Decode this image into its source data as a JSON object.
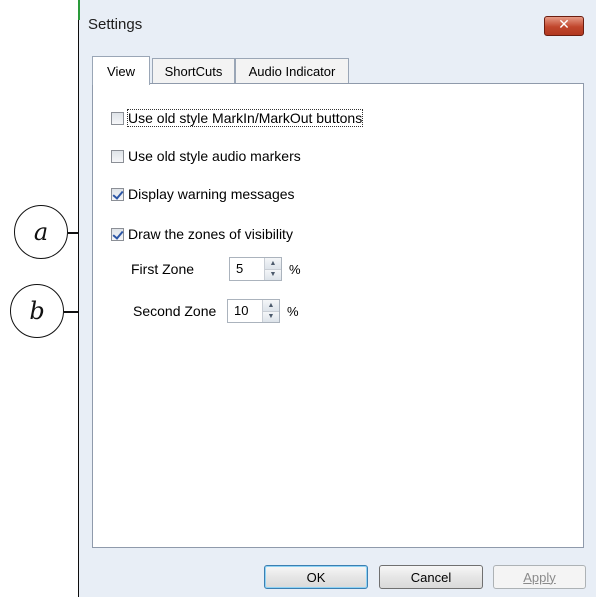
{
  "window": {
    "title": "Settings",
    "close_glyph": "✕"
  },
  "tabs": [
    {
      "label": "View",
      "active": true
    },
    {
      "label": "ShortCuts",
      "active": false
    },
    {
      "label": "Audio Indicator",
      "active": false
    }
  ],
  "options": [
    {
      "label": "Use old style MarkIn/MarkOut buttons",
      "checked": false
    },
    {
      "label": "Use old style audio markers",
      "checked": false
    },
    {
      "label": "Display warning messages",
      "checked": true
    },
    {
      "label": "Draw the zones of visibility",
      "checked": true
    }
  ],
  "zones": {
    "first": {
      "label": "First Zone",
      "value": "5",
      "unit": "%"
    },
    "second": {
      "label": "Second Zone",
      "value": "10",
      "unit": "%"
    }
  },
  "buttons": {
    "ok": "OK",
    "cancel": "Cancel",
    "apply": "Apply"
  },
  "callouts": {
    "a": "a",
    "b": "b"
  },
  "icons": {
    "close": "close-icon",
    "spin_up": "arrow-up-icon",
    "spin_down": "arrow-down-icon",
    "check": "check-icon"
  },
  "colors": {
    "window_bg": "#e8eef6",
    "close_button": "#c0462c",
    "check_mark": "#2d57a6"
  }
}
